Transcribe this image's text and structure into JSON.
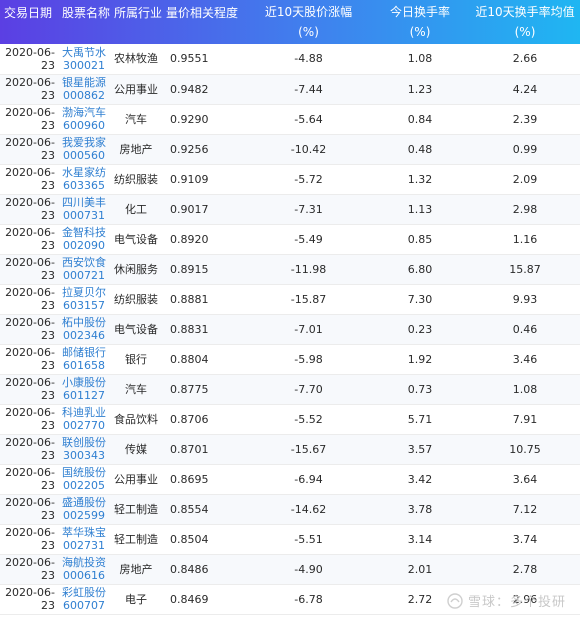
{
  "headers": {
    "date": "交易日期",
    "name": "股票名称",
    "industry": "所属行业",
    "corr": "量价相关程度",
    "change_1": "近10天股价涨幅",
    "change_2": "(%)",
    "turnover_1": "今日换手率",
    "turnover_2": "(%)",
    "avg_1": "近10天换手率均值",
    "avg_2": "(%)"
  },
  "rows": [
    {
      "date1": "2020-06-",
      "date2": "23",
      "name": "大禹节水",
      "code": "300021",
      "industry": "农林牧渔",
      "corr": "0.9551",
      "change": "-4.88",
      "turnover": "1.08",
      "avg": "2.66"
    },
    {
      "date1": "2020-06-",
      "date2": "23",
      "name": "银星能源",
      "code": "000862",
      "industry": "公用事业",
      "corr": "0.9482",
      "change": "-7.44",
      "turnover": "1.23",
      "avg": "4.24"
    },
    {
      "date1": "2020-06-",
      "date2": "23",
      "name": "渤海汽车",
      "code": "600960",
      "industry": "汽车",
      "corr": "0.9290",
      "change": "-5.64",
      "turnover": "0.84",
      "avg": "2.39"
    },
    {
      "date1": "2020-06-",
      "date2": "23",
      "name": "我爱我家",
      "code": "000560",
      "industry": "房地产",
      "corr": "0.9256",
      "change": "-10.42",
      "turnover": "0.48",
      "avg": "0.99"
    },
    {
      "date1": "2020-06-",
      "date2": "23",
      "name": "水星家纺",
      "code": "603365",
      "industry": "纺织服装",
      "corr": "0.9109",
      "change": "-5.72",
      "turnover": "1.32",
      "avg": "2.09"
    },
    {
      "date1": "2020-06-",
      "date2": "23",
      "name": "四川美丰",
      "code": "000731",
      "industry": "化工",
      "corr": "0.9017",
      "change": "-7.31",
      "turnover": "1.13",
      "avg": "2.98"
    },
    {
      "date1": "2020-06-",
      "date2": "23",
      "name": "金智科技",
      "code": "002090",
      "industry": "电气设备",
      "corr": "0.8920",
      "change": "-5.49",
      "turnover": "0.85",
      "avg": "1.16"
    },
    {
      "date1": "2020-06-",
      "date2": "23",
      "name": "西安饮食",
      "code": "000721",
      "industry": "休闲服务",
      "corr": "0.8915",
      "change": "-11.98",
      "turnover": "6.80",
      "avg": "15.87"
    },
    {
      "date1": "2020-06-",
      "date2": "23",
      "name": "拉夏贝尔",
      "code": "603157",
      "industry": "纺织服装",
      "corr": "0.8881",
      "change": "-15.87",
      "turnover": "7.30",
      "avg": "9.93"
    },
    {
      "date1": "2020-06-",
      "date2": "23",
      "name": "柘中股份",
      "code": "002346",
      "industry": "电气设备",
      "corr": "0.8831",
      "change": "-7.01",
      "turnover": "0.23",
      "avg": "0.46"
    },
    {
      "date1": "2020-06-",
      "date2": "23",
      "name": "邮储银行",
      "code": "601658",
      "industry": "银行",
      "corr": "0.8804",
      "change": "-5.98",
      "turnover": "1.92",
      "avg": "3.46"
    },
    {
      "date1": "2020-06-",
      "date2": "23",
      "name": "小康股份",
      "code": "601127",
      "industry": "汽车",
      "corr": "0.8775",
      "change": "-7.70",
      "turnover": "0.73",
      "avg": "1.08"
    },
    {
      "date1": "2020-06-",
      "date2": "23",
      "name": "科迪乳业",
      "code": "002770",
      "industry": "食品饮料",
      "corr": "0.8706",
      "change": "-5.52",
      "turnover": "5.71",
      "avg": "7.91"
    },
    {
      "date1": "2020-06-",
      "date2": "23",
      "name": "联创股份",
      "code": "300343",
      "industry": "传媒",
      "corr": "0.8701",
      "change": "-15.67",
      "turnover": "3.57",
      "avg": "10.75"
    },
    {
      "date1": "2020-06-",
      "date2": "23",
      "name": "国统股份",
      "code": "002205",
      "industry": "公用事业",
      "corr": "0.8695",
      "change": "-6.94",
      "turnover": "3.42",
      "avg": "3.64"
    },
    {
      "date1": "2020-06-",
      "date2": "23",
      "name": "盛通股份",
      "code": "002599",
      "industry": "轻工制造",
      "corr": "0.8554",
      "change": "-14.62",
      "turnover": "3.78",
      "avg": "7.12"
    },
    {
      "date1": "2020-06-",
      "date2": "23",
      "name": "萃华珠宝",
      "code": "002731",
      "industry": "轻工制造",
      "corr": "0.8504",
      "change": "-5.51",
      "turnover": "3.14",
      "avg": "3.74"
    },
    {
      "date1": "2020-06-",
      "date2": "23",
      "name": "海航投资",
      "code": "000616",
      "industry": "房地产",
      "corr": "0.8486",
      "change": "-4.90",
      "turnover": "2.01",
      "avg": "2.78"
    },
    {
      "date1": "2020-06-",
      "date2": "23",
      "name": "彩虹股份",
      "code": "600707",
      "industry": "电子",
      "corr": "0.8469",
      "change": "-6.78",
      "turnover": "2.72",
      "avg": "2.96"
    }
  ],
  "watermark": {
    "text": "雪球：多个投研",
    "icon": "snowball-icon"
  }
}
